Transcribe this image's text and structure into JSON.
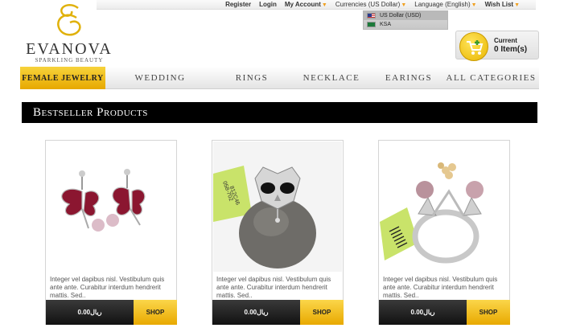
{
  "brand": {
    "name": "EVANOVA",
    "tagline": "SPARKLING BEAUTY"
  },
  "toplinks": {
    "register": "Register",
    "login": "Login",
    "my_account": "My Account",
    "currencies": "Currencies (US Dollar)",
    "language": "Language (English)",
    "wish_list": "Wish List"
  },
  "currency_dropdown": {
    "options": [
      {
        "label": "US Dollar (USD)",
        "flag": "us-flag-icon"
      },
      {
        "label": "KSA",
        "flag": "ksa-flag-icon"
      }
    ]
  },
  "cart": {
    "title": "Current",
    "items": "0 Item(s)",
    "icon": "cart-icon"
  },
  "nav": {
    "items": [
      {
        "label": "Female Jewelry",
        "active": true
      },
      {
        "label": "Wedding"
      },
      {
        "label": "Rings"
      },
      {
        "label": "necklace"
      },
      {
        "label": "Earings"
      },
      {
        "label": "All categories"
      }
    ]
  },
  "section": {
    "title": "Bestseller Products"
  },
  "products": [
    {
      "image": "earrings-image",
      "desc": "Integer vel dapibus nisl. Vestibulum quis ante ante. Curabitur interdum hendrerit mattis. Sed..",
      "price": "0.00ريال",
      "shop": "SHOP"
    },
    {
      "image": "owl-ring-image",
      "desc": "Integer vel dapibus nisl. Vestibulum quis ante ante. Curabitur interdum hendrerit mattis. Sed..",
      "price": "0.00ريال",
      "shop": "SHOP"
    },
    {
      "image": "pearl-ring-image",
      "desc": "Integer vel dapibus nisl. Vestibulum quis ante ante. Curabitur interdum hendrerit mattis. Sed..",
      "price": "0.00ريال",
      "shop": "SHOP"
    }
  ],
  "colors": {
    "accent": "#e9b000",
    "header_bg": "#000000"
  }
}
